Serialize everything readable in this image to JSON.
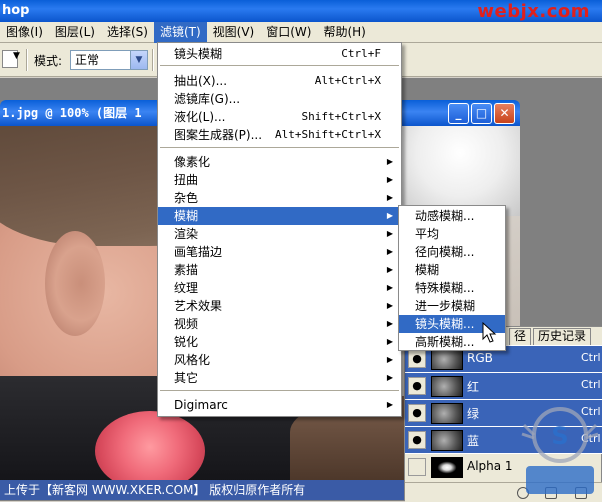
{
  "app": {
    "title": "hop",
    "watermark": "webjx.com"
  },
  "menubar": [
    {
      "label": "图像(I)",
      "active": false
    },
    {
      "label": "图层(L)",
      "active": false
    },
    {
      "label": "选择(S)",
      "active": false
    },
    {
      "label": "滤镜(T)",
      "active": true
    },
    {
      "label": "视图(V)",
      "active": false
    },
    {
      "label": "窗口(W)",
      "active": false
    },
    {
      "label": "帮助(H)",
      "active": false
    }
  ],
  "options": {
    "mode_label": "模式:",
    "mode_value": "正常"
  },
  "document": {
    "title": "1.jpg @ 100% (图层 1"
  },
  "caption": "上传于【新客网 WWW.XKER.COM】 版权归原作者所有",
  "filter_menu": {
    "items": [
      {
        "label": "镜头模糊",
        "shortcut": "Ctrl+F",
        "submenu": false
      },
      {
        "label": "抽出(X)...",
        "shortcut": "Alt+Ctrl+X",
        "submenu": false
      },
      {
        "label": "滤镜库(G)...",
        "shortcut": "",
        "submenu": false
      },
      {
        "label": "液化(L)...",
        "shortcut": "Shift+Ctrl+X",
        "submenu": false
      },
      {
        "label": "图案生成器(P)...",
        "shortcut": "Alt+Shift+Ctrl+X",
        "submenu": false
      },
      {
        "label": "像素化",
        "shortcut": "",
        "submenu": true
      },
      {
        "label": "扭曲",
        "shortcut": "",
        "submenu": true
      },
      {
        "label": "杂色",
        "shortcut": "",
        "submenu": true
      },
      {
        "label": "模糊",
        "shortcut": "",
        "submenu": true,
        "highlighted": true
      },
      {
        "label": "渲染",
        "shortcut": "",
        "submenu": true
      },
      {
        "label": "画笔描边",
        "shortcut": "",
        "submenu": true
      },
      {
        "label": "素描",
        "shortcut": "",
        "submenu": true
      },
      {
        "label": "纹理",
        "shortcut": "",
        "submenu": true
      },
      {
        "label": "艺术效果",
        "shortcut": "",
        "submenu": true
      },
      {
        "label": "视频",
        "shortcut": "",
        "submenu": true
      },
      {
        "label": "锐化",
        "shortcut": "",
        "submenu": true
      },
      {
        "label": "风格化",
        "shortcut": "",
        "submenu": true
      },
      {
        "label": "其它",
        "shortcut": "",
        "submenu": true
      },
      {
        "label": "Digimarc",
        "shortcut": "",
        "submenu": true
      }
    ]
  },
  "blur_menu": {
    "items": [
      {
        "label": "动感模糊..."
      },
      {
        "label": "平均"
      },
      {
        "label": "径向模糊..."
      },
      {
        "label": "模糊"
      },
      {
        "label": "特殊模糊..."
      },
      {
        "label": "进一步模糊"
      },
      {
        "label": "镜头模糊...",
        "highlighted": true
      },
      {
        "label": "高斯模糊..."
      }
    ]
  },
  "panel": {
    "tab_paths": "径",
    "tab_history": "历史记录",
    "channels": [
      {
        "name": "RGB",
        "shortcut": "Ctrl",
        "selected": true
      },
      {
        "name": "红",
        "shortcut": "Ctrl",
        "selected": true
      },
      {
        "name": "绿",
        "shortcut": "Ctrl",
        "selected": true
      },
      {
        "name": "蓝",
        "shortcut": "Ctrl",
        "selected": true
      },
      {
        "name": "Alpha 1",
        "shortcut": "",
        "selected": false
      }
    ]
  },
  "colors": {
    "highlight": "#316ac5",
    "titlebar": "#0a5fd8",
    "watermark": "#e0201c"
  }
}
